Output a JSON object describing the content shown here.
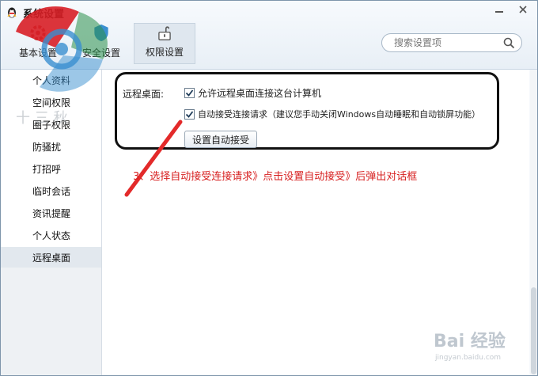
{
  "window": {
    "title": "系统设置",
    "minimize_icon": "minimize-icon",
    "close_icon": "close-icon"
  },
  "toolbar": {
    "items": [
      {
        "label": "基本设置",
        "icon": "gear-icon"
      },
      {
        "label": "安全设置",
        "icon": "shield-icon"
      },
      {
        "label": "权限设置",
        "icon": "unlock-icon",
        "active": true
      }
    ]
  },
  "search": {
    "placeholder": "搜索设置项",
    "icon": "search-icon"
  },
  "sidebar": {
    "items": [
      {
        "label": "个人资料"
      },
      {
        "label": "空间权限"
      },
      {
        "label": "圈子权限"
      },
      {
        "label": "防骚扰"
      },
      {
        "label": "打招呼"
      },
      {
        "label": "临时会话"
      },
      {
        "label": "资讯提醒"
      },
      {
        "label": "个人状态"
      },
      {
        "label": "远程桌面",
        "selected": true
      }
    ]
  },
  "remote": {
    "label": "远程桌面:",
    "option1": {
      "label": "允许远程桌面连接这台计算机",
      "checked": true
    },
    "option2": {
      "label": "自动接受连接请求（建议您手动关闭Windows自动睡眠和自动锁屏功能）",
      "checked": true
    },
    "button": "设置自动接受"
  },
  "annotation": {
    "text": "3、选择自动接受连接请求》点击设置自动接受》后弹出对话框",
    "color": "#d72020"
  },
  "watermark": {
    "brand": "Bai 经验",
    "url": "jingyan.baidu.com"
  },
  "colors": {
    "accent": "#3a8fd0",
    "annotation": "#d72020",
    "frame": "#111111"
  }
}
